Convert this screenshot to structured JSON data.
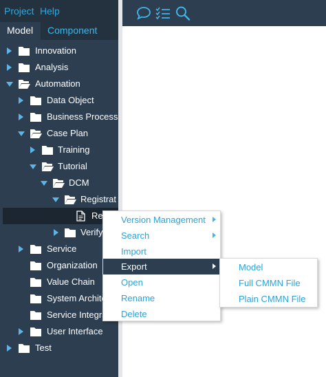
{
  "menubar": {
    "items": [
      {
        "label": "Project"
      },
      {
        "label": "Help"
      }
    ]
  },
  "tabs": [
    {
      "label": "Model",
      "active": true
    },
    {
      "label": "Component",
      "active": false
    }
  ],
  "toolbar": {
    "icons": [
      "chat-icon",
      "checklist-icon",
      "search-icon"
    ]
  },
  "tree": {
    "rows": [
      {
        "label": "Innovation",
        "expanded": false,
        "type": "folder"
      },
      {
        "label": "Analysis",
        "expanded": false,
        "type": "folder"
      },
      {
        "label": "Automation",
        "expanded": true,
        "type": "folder"
      },
      {
        "label": "Data Object",
        "expanded": false,
        "type": "folder"
      },
      {
        "label": "Business Process",
        "expanded": false,
        "type": "folder"
      },
      {
        "label": "Case Plan",
        "expanded": true,
        "type": "folder"
      },
      {
        "label": "Training",
        "expanded": false,
        "type": "folder"
      },
      {
        "label": "Tutorial",
        "expanded": true,
        "type": "folder"
      },
      {
        "label": "DCM",
        "expanded": true,
        "type": "folder"
      },
      {
        "label": "Registrat",
        "expanded": true,
        "type": "folder"
      },
      {
        "label": "Re",
        "type": "file",
        "selected": true
      },
      {
        "label": "Verify",
        "expanded": false,
        "type": "folder"
      },
      {
        "label": "Service",
        "expanded": false,
        "type": "folder"
      },
      {
        "label": "Organization",
        "type": "folder"
      },
      {
        "label": "Value Chain",
        "type": "folder"
      },
      {
        "label": "System Archite",
        "type": "folder"
      },
      {
        "label": "Service Integra",
        "type": "folder"
      },
      {
        "label": "User Interface",
        "expanded": false,
        "type": "folder"
      },
      {
        "label": "Test",
        "expanded": false,
        "type": "folder"
      }
    ]
  },
  "context_menu": {
    "items": [
      {
        "label": "Version Management",
        "submenu": true
      },
      {
        "label": "Search",
        "submenu": true
      },
      {
        "label": "Import",
        "submenu": false
      },
      {
        "label": "Export",
        "submenu": true,
        "active": true
      },
      {
        "label": "Open",
        "submenu": false
      },
      {
        "label": "Rename",
        "submenu": false
      },
      {
        "label": "Delete",
        "submenu": false
      }
    ]
  },
  "export_submenu": {
    "items": [
      {
        "label": "Model"
      },
      {
        "label": "Full CMMN File"
      },
      {
        "label": "Plain CMMN File"
      }
    ]
  },
  "colors": {
    "panel": "#2c3e50",
    "accent": "#29a9e1",
    "menubar": "#24323f",
    "selected_row": "#1c2630"
  }
}
